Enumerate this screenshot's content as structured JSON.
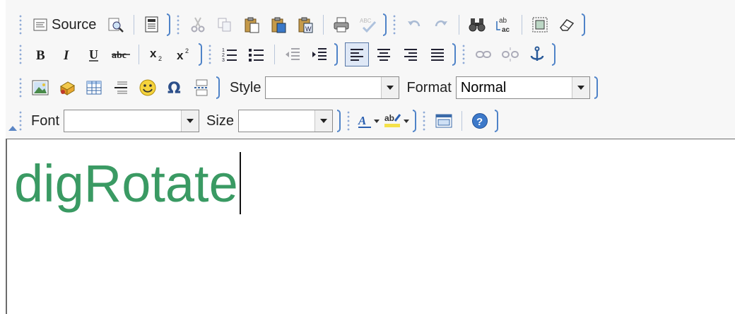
{
  "toolbar": {
    "source_label": "Source",
    "style_label": "Style",
    "style_value": "",
    "format_label": "Format",
    "format_value": "Normal",
    "font_label": "Font",
    "font_value": "",
    "size_label": "Size",
    "size_value": ""
  },
  "content": {
    "text": "digRotate",
    "text_color": "#3a9a63"
  },
  "colors": {
    "toolbar_bg": "#f7f7f7",
    "group_border": "#4f83c8",
    "active_bg": "#dfe8f6"
  }
}
